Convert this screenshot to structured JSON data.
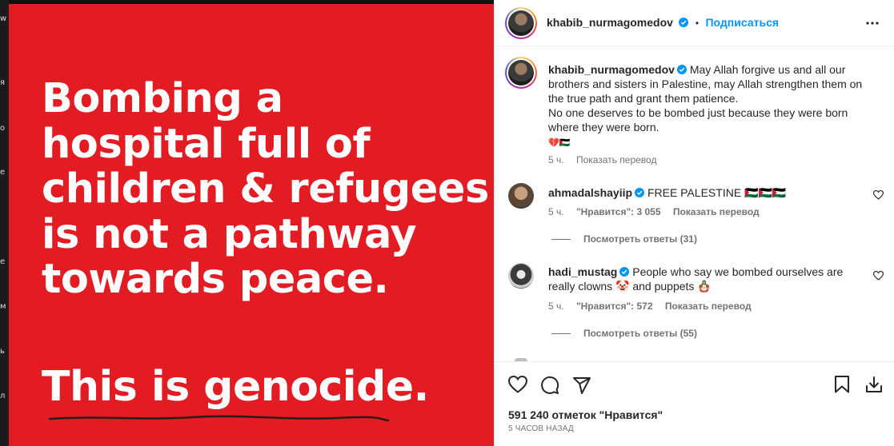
{
  "post_image": {
    "headline_lines": [
      "Bombing a",
      "hospital full of",
      "children & refugees",
      "is not a pathway",
      "towards peace."
    ],
    "tagline": "This is genocide.",
    "background_color": "#e31b23"
  },
  "background_strip_glyphs": [
    "w",
    "я",
    "о",
    "е",
    "е",
    "м",
    "ь",
    "л"
  ],
  "header": {
    "username": "khabib_nurmagomedov",
    "separator": "•",
    "follow_label": "Подписаться",
    "more_icon": "more-horizontal-icon"
  },
  "caption": {
    "username": "khabib_nurmagomedov",
    "text": "May Allah forgive us and all our brothers and sisters in Palestine, may Allah strengthen them on the true path and grant them patience.",
    "text_2": "No one deserves to be bombed just because they were born where they were born.",
    "emoji": "💔🇵🇸",
    "time": "5 ч.",
    "translate": "Показать перевод"
  },
  "comments": [
    {
      "username": "ahmadalshayiip",
      "text": "FREE PALESTINE 🇵🇸🇵🇸🇵🇸",
      "time": "5 ч.",
      "likes": "\"Нравится\": 3 055",
      "translate": "Показать перевод",
      "replies": "Посмотреть ответы (31)"
    },
    {
      "username": "hadi_mustag",
      "text": "People who say we bombed ourselves are really clowns 🤡 and puppets 🪆",
      "time": "5 ч.",
      "likes": "\"Нравится\": 572",
      "translate": "Показать перевод",
      "replies": "Посмотреть ответы (55)"
    }
  ],
  "footer": {
    "likes": "591 240 отметок \"Нравится\"",
    "timestamp": "5 ЧАСОВ НАЗАД"
  },
  "colors": {
    "accent": "#0095f6",
    "verified": "#0095f6",
    "muted": "#737373"
  }
}
